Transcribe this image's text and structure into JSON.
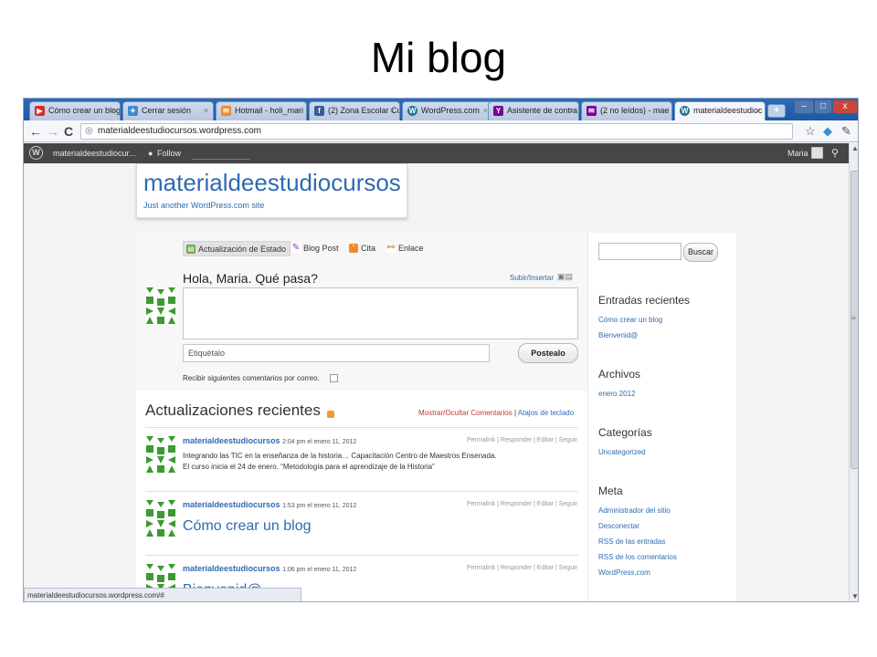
{
  "slide": {
    "title": "Mi blog"
  },
  "browser": {
    "tabs": [
      {
        "label": "Cómo crear un blog",
        "icon": "youtube-icon",
        "color": "#d62b23"
      },
      {
        "label": "Cerrar sesión",
        "icon": "windows-live-icon",
        "color": "#3d8bd2"
      },
      {
        "label": "Hotmail - holi_mari",
        "icon": "hotmail-icon",
        "color": "#f08a24"
      },
      {
        "label": "(2) Zona Escolar Cu",
        "icon": "facebook-icon",
        "color": "#3b5998"
      },
      {
        "label": "WordPress.com",
        "icon": "wordpress-icon",
        "color": "#21759b"
      },
      {
        "label": "Asistente de contra",
        "icon": "yahoo-icon",
        "color": "#7b0099"
      },
      {
        "label": "(2 no leídos) - mae",
        "icon": "mail-icon",
        "color": "#7b0099"
      },
      {
        "label": "materialdeestudioc",
        "icon": "wordpress-icon",
        "color": "#21759b"
      }
    ],
    "new_tab": "+",
    "window_buttons": {
      "minimize": "–",
      "maximize": "□",
      "close": "x"
    },
    "url": "materialdeestudiocursos.wordpress.com",
    "status_url": "materialdeestudiocursos.wordpress.com/#"
  },
  "adminbar": {
    "site": "materialdeestudiocur...",
    "follow": "Follow",
    "user": "Maria"
  },
  "site": {
    "title": "materialdeestudiocursos",
    "tagline": "Just another WordPress.com site"
  },
  "postbox": {
    "tabs": [
      "Actualización de Estado",
      "Blog Post",
      "Cita",
      "Enlace"
    ],
    "greeting": "Hola, Maria. Qué pasa?",
    "upload": "Subir/Insertar",
    "tags_placeholder": "Etiquétalo",
    "submit": "Postealo",
    "notify": "Recibir siguientes comentarios por correo."
  },
  "updates": {
    "title": "Actualizaciones recientes",
    "toggle_comments": "Mostrar/Ocultar Comentarios",
    "separator": "|",
    "shortcuts": "Atajos de teclado",
    "actions": "Permalink | Responder | Editar | Seguir",
    "entries": [
      {
        "author": "materialdeestudiocursos",
        "date": "2:04 pm el enero 11, 2012",
        "line1": "Integrando las TIC en la enseñanza de la historia… Capacitación Centro de Maestros Ensenada.",
        "line2": "El curso inicia el 24 de enero. “Metodología para el aprendizaje de la Historia”"
      },
      {
        "author": "materialdeestudiocursos",
        "date": "1:53 pm el enero 11, 2012",
        "headline": "Cómo crear un blog"
      },
      {
        "author": "materialdeestudiocursos",
        "date": "1:06 pm el enero 11, 2012",
        "headline": "Bienvenid@"
      }
    ]
  },
  "sidebar": {
    "search_button": "Buscar",
    "recent_title": "Entradas recientes",
    "recent": [
      "Cómo crear un blog",
      "Bienvenid@"
    ],
    "archives_title": "Archivos",
    "archives": [
      "enero 2012"
    ],
    "categories_title": "Categorías",
    "categories": [
      "Uncategorized"
    ],
    "meta_title": "Meta",
    "meta": [
      "Administrador del sitio",
      "Desconectar",
      "RSS de las entradas",
      "RSS de los comentarios",
      "WordPress.com"
    ]
  }
}
